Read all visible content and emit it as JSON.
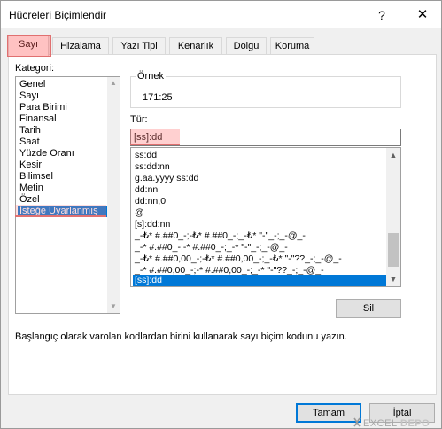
{
  "window": {
    "title": "Hücreleri Biçimlendir",
    "help_glyph": "?",
    "close_glyph": "✕"
  },
  "tabs": [
    {
      "label": "Sayı",
      "active": true
    },
    {
      "label": "Hizalama"
    },
    {
      "label": "Yazı Tipi"
    },
    {
      "label": "Kenarlık"
    },
    {
      "label": "Dolgu"
    },
    {
      "label": "Koruma"
    }
  ],
  "category": {
    "label": "Kategori:",
    "items": [
      "Genel",
      "Sayı",
      "Para Birimi",
      "Finansal",
      "Tarih",
      "Saat",
      "Yüzde Oranı",
      "Kesir",
      "Bilimsel",
      "Metin",
      "Özel",
      "İsteğe Uyarlanmış"
    ],
    "selected": "İsteğe Uyarlanmış"
  },
  "sample": {
    "label": "Örnek",
    "value": "171:25"
  },
  "type": {
    "label": "Tür:",
    "value": "[ss]:dd"
  },
  "format_list": {
    "items": [
      "ss:dd",
      "ss:dd:nn",
      "g.aa.yyyy ss:dd",
      "dd:nn",
      "dd:nn,0",
      "@",
      "[s]:dd:nn",
      "_-₺* #.##0_-;-₺* #.##0_-;_-₺* \"-\"_-;_-@_-",
      "_-* #.##0_-;-* #.##0_-;_-* \"-\"_-;_-@_-",
      "_-₺* #.##0,00_-;-₺* #.##0,00_-;_-₺* \"-\"??_-;_-@_-",
      "_-* #.##0,00_-;-* #.##0,00_-;_-* \"-\"??_-;_-@_-",
      "[ss]:dd"
    ],
    "selected": "[ss]:dd"
  },
  "buttons": {
    "delete": "Sil",
    "ok": "Tamam",
    "cancel": "İptal"
  },
  "hint": "Başlangıç olarak varolan kodlardan birini kullanarak sayı biçim kodunu yazın.",
  "watermark": "EXCELDEPO",
  "colors": {
    "selection": "#0078d7",
    "highlight": "#e07070"
  }
}
